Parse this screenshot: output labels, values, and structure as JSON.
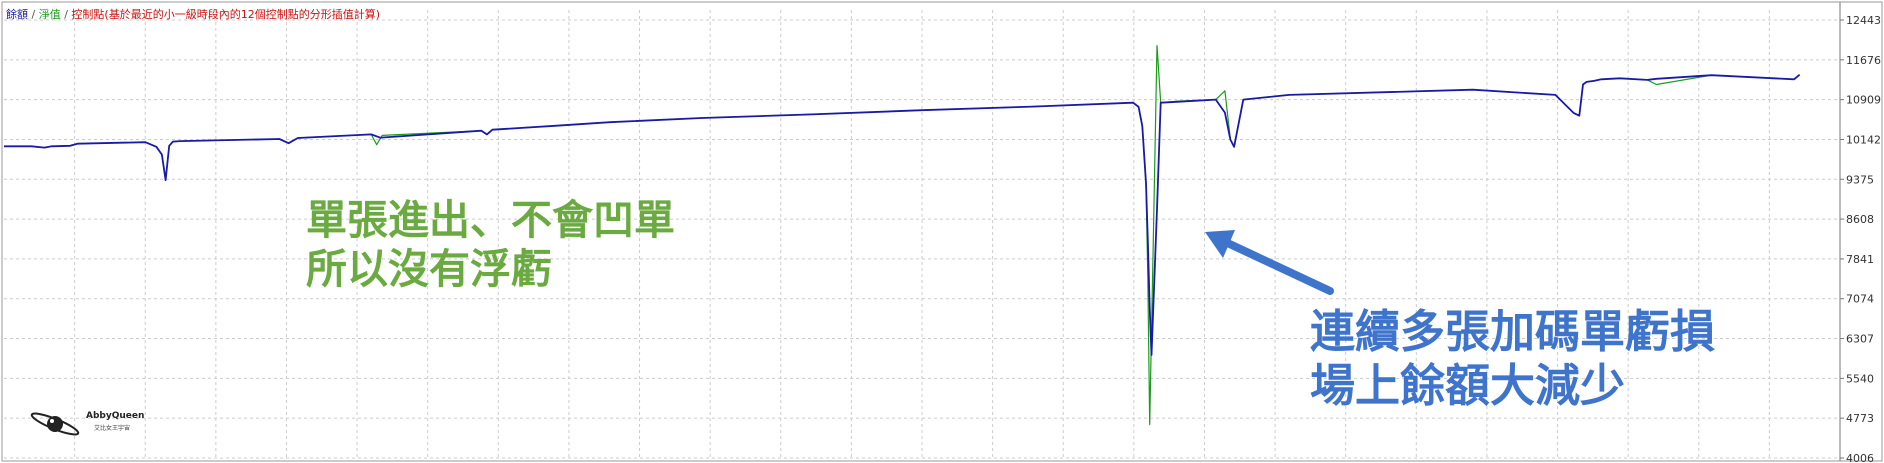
{
  "legend": {
    "balance": "餘額",
    "sep1": " / ",
    "equity": "淨值",
    "sep2": " / ",
    "note": "控制點(基於最近的小一級時段內的12個控制點的分形插值計算)"
  },
  "annotations": {
    "green_line1": "單張進出、不會凹單",
    "green_line2": "所以沒有浮虧",
    "blue_line1": "連續多張加碼單虧損",
    "blue_line2": "場上餘額大減少"
  },
  "logo": {
    "name": "AbbyQueen",
    "subtitle": "艾比女王宇宙"
  },
  "colors": {
    "balance": "#1a1aa6",
    "equity": "#1a9c1a",
    "grid": "#cccccc",
    "arrow": "#3f74cc",
    "green_text": "#6aaa40"
  },
  "chart_data": {
    "type": "line",
    "title": "",
    "xlabel": "",
    "ylabel": "",
    "ylim": [
      4006,
      12443
    ],
    "yticks": [
      12443,
      11676,
      10909,
      10142,
      9375,
      8608,
      7841,
      7074,
      6307,
      5540,
      4773,
      4006
    ],
    "grid": true,
    "x_range": [
      0,
      1000
    ],
    "series": [
      {
        "name": "餘額",
        "color": "#1a1aa6",
        "x": [
          0,
          15,
          22,
          26,
          36,
          40,
          77,
          83,
          86,
          88,
          90,
          92,
          96,
          150,
          155,
          160,
          200,
          205,
          260,
          263,
          266,
          300,
          330,
          380,
          440,
          500,
          560,
          615,
          618,
          620,
          622,
          623,
          624,
          625,
          628,
          630,
          640,
          660,
          665,
          668,
          670,
          675,
          700,
          800,
          845,
          855,
          858,
          860,
          862,
          866,
          870,
          880,
          895,
          900,
          930,
          975,
          978
        ],
        "y": [
          10010,
          10010,
          9985,
          10010,
          10020,
          10060,
          10090,
          10000,
          9850,
          9360,
          10020,
          10100,
          10110,
          10150,
          10070,
          10170,
          10240,
          10175,
          10310,
          10240,
          10330,
          10405,
          10475,
          10555,
          10625,
          10705,
          10775,
          10850,
          10770,
          10400,
          9300,
          8200,
          6900,
          5990,
          8800,
          10850,
          10870,
          10910,
          10660,
          10140,
          10000,
          10910,
          11000,
          11100,
          11000,
          10650,
          10600,
          11200,
          11250,
          11270,
          11300,
          11320,
          11290,
          11310,
          11380,
          11300,
          11390
        ]
      },
      {
        "name": "淨值",
        "color": "#1a9c1a",
        "x": [
          0,
          15,
          22,
          26,
          36,
          40,
          77,
          83,
          86,
          88,
          90,
          92,
          96,
          150,
          155,
          160,
          200,
          203,
          206,
          260,
          263,
          266,
          300,
          330,
          380,
          440,
          500,
          560,
          615,
          618,
          620,
          622,
          623,
          624,
          626,
          628,
          630,
          640,
          660,
          665,
          668,
          670,
          675,
          700,
          800,
          845,
          855,
          858,
          860,
          862,
          866,
          870,
          880,
          895,
          900,
          930,
          975,
          978
        ],
        "y": [
          10010,
          10010,
          9985,
          10010,
          10020,
          10060,
          10090,
          10000,
          9850,
          9360,
          10020,
          10100,
          10110,
          10150,
          10070,
          10170,
          10240,
          10040,
          10220,
          10310,
          10240,
          10330,
          10405,
          10475,
          10555,
          10625,
          10705,
          10775,
          10850,
          10770,
          10400,
          9300,
          7500,
          4650,
          8200,
          11950,
          10850,
          10880,
          10910,
          11080,
          10140,
          10000,
          10910,
          11000,
          11100,
          11000,
          10650,
          10600,
          11200,
          11250,
          11270,
          11300,
          11320,
          11290,
          11200,
          11380,
          11300,
          11390
        ]
      }
    ]
  }
}
